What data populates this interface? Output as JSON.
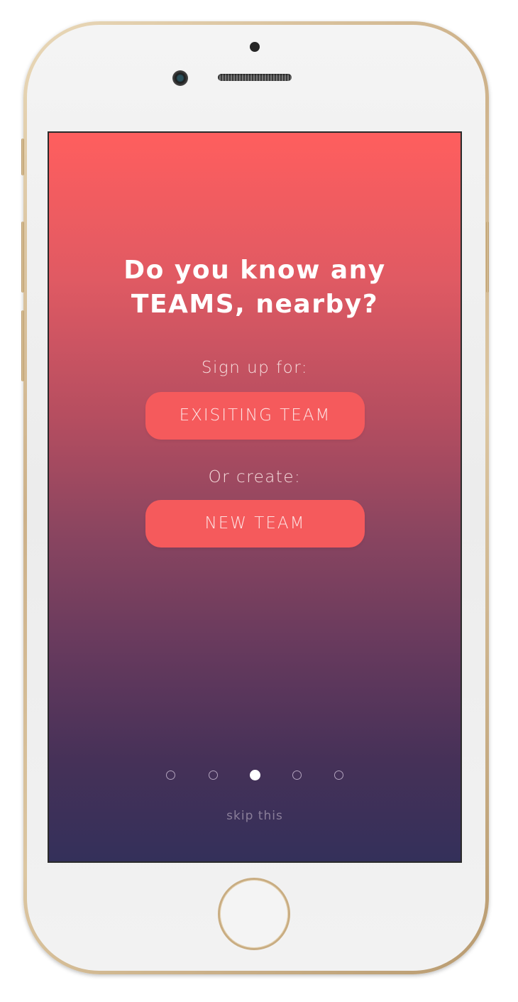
{
  "onboarding": {
    "headline_line1": "Do you know any",
    "headline_line2": "TEAMS, nearby?",
    "signup_label": "Sign up for:",
    "existing_team_button": "EXISITING TEAM",
    "create_label": "Or create:",
    "new_team_button": "NEW TEAM",
    "skip_link": "skip this"
  },
  "pager": {
    "total_pages": 5,
    "current_page": 3
  },
  "colors": {
    "gradient_top": "#ff5e5e",
    "gradient_bottom": "#34305a",
    "button_fill": "#f55a5c",
    "phone_frame": "#cdb189"
  }
}
